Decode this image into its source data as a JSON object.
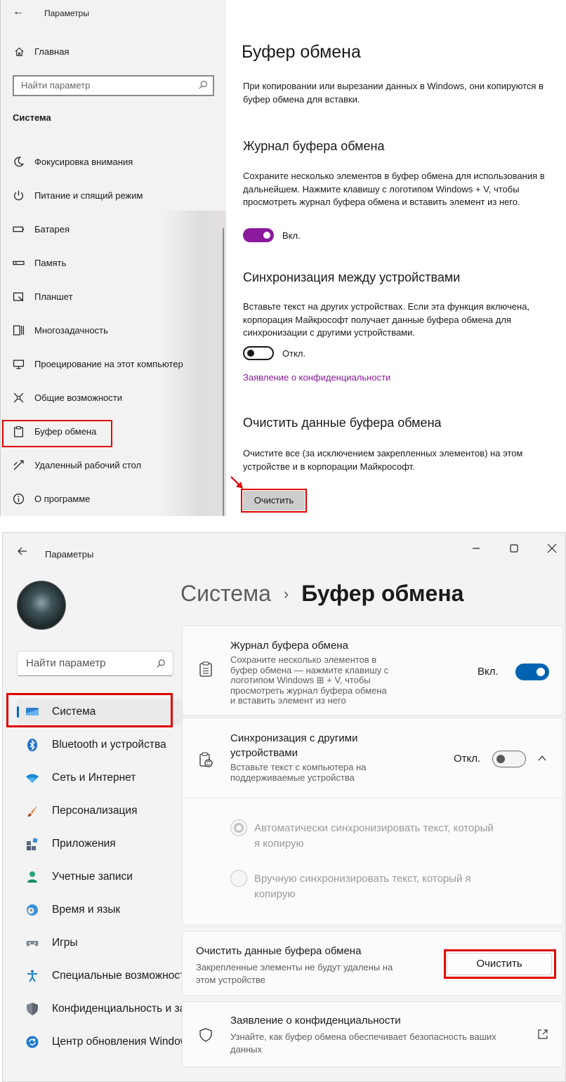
{
  "w10": {
    "app_title": "Параметры",
    "home_label": "Главная",
    "search_placeholder": "Найти параметр",
    "section_title": "Система",
    "nav": [
      {
        "label": "Фокусировка внимания",
        "icon": "moon-icon"
      },
      {
        "label": "Питание и спящий режим",
        "icon": "power-icon"
      },
      {
        "label": "Батарея",
        "icon": "battery-icon"
      },
      {
        "label": "Память",
        "icon": "storage-icon"
      },
      {
        "label": "Планшет",
        "icon": "tablet-icon"
      },
      {
        "label": "Многозадачность",
        "icon": "multitasking-icon"
      },
      {
        "label": "Проецирование на этот компьютер",
        "icon": "projecting-icon"
      },
      {
        "label": "Общие возможности",
        "icon": "shared-experiences-icon"
      },
      {
        "label": "Буфер обмена",
        "icon": "clipboard-icon",
        "selected": true
      },
      {
        "label": "Удаленный рабочий стол",
        "icon": "remote-desktop-icon"
      },
      {
        "label": "О программе",
        "icon": "info-icon"
      }
    ],
    "page_title": "Буфер обмена",
    "intro": "При копировании или вырезании данных в Windows, они копируются в буфер обмена для вставки.",
    "history": {
      "title": "Журнал буфера обмена",
      "desc": "Сохраните несколько элементов в буфер обмена для использования в дальнейшем. Нажмите клавишу с логотипом Windows + V, чтобы просмотреть журнал буфера обмена и вставить элемент из него.",
      "state": "Вкл."
    },
    "sync": {
      "title": "Синхронизация между устройствами",
      "desc": "Вставьте текст на других устройствах. Если эта функция включена, корпорация Майкрософт получает данные буфера обмена для синхронизации с другими устройствами.",
      "state": "Откл."
    },
    "privacy_link": "Заявление о конфиденциальности",
    "clear": {
      "title": "Очистить данные буфера обмена",
      "desc": "Очистите все (за исключением закрепленных элементов) на этом устройстве и в корпорации Майкрософт.",
      "button": "Очистить"
    },
    "colors": {
      "accent": "#8a1a9b",
      "highlight": "#e00000"
    }
  },
  "w11": {
    "app_title": "Параметры",
    "search_placeholder": "Найти параметр",
    "nav": [
      {
        "label": "Система",
        "icon": "display-icon",
        "selected": true
      },
      {
        "label": "Bluetooth и устройства",
        "icon": "bluetooth-icon"
      },
      {
        "label": "Сеть и Интернет",
        "icon": "wifi-icon"
      },
      {
        "label": "Персонализация",
        "icon": "brush-icon"
      },
      {
        "label": "Приложения",
        "icon": "apps-icon"
      },
      {
        "label": "Учетные записи",
        "icon": "person-icon"
      },
      {
        "label": "Время и язык",
        "icon": "globe-clock-icon"
      },
      {
        "label": "Игры",
        "icon": "gamepad-icon"
      },
      {
        "label": "Специальные возможности",
        "icon": "accessibility-icon"
      },
      {
        "label": "Конфиденциальность и защита",
        "icon": "shield-icon"
      },
      {
        "label": "Центр обновления Windows",
        "icon": "update-icon"
      }
    ],
    "breadcrumb": {
      "parent": "Система",
      "separator": "›",
      "current": "Буфер обмена"
    },
    "history": {
      "title": "Журнал буфера обмена",
      "desc_lines": [
        "Сохраните несколько элементов в",
        "буфер обмена — нажмите клавишу с",
        "логотипом Windows ⊞ + V, чтобы",
        "просмотреть журнал буфера обмена",
        "и вставить элемент из него"
      ],
      "state": "Вкл."
    },
    "sync": {
      "title_lines": [
        "Синхронизация с другими",
        "устройствами"
      ],
      "desc_lines": [
        "Вставьте текст с компьютера на",
        "поддерживаемые устройства"
      ],
      "state": "Откл.",
      "options": [
        {
          "lines": [
            "Автоматически синхронизировать текст, который",
            "я копирую"
          ]
        },
        {
          "lines": [
            "Вручную синхронизировать текст, который я",
            "копирую"
          ]
        }
      ]
    },
    "clear": {
      "title": "Очистить данные буфера обмена",
      "desc_lines": [
        "Закрепленные элементы не будут удалены на",
        "этом устройстве"
      ],
      "button": "Очистить"
    },
    "privacy": {
      "title": "Заявление о конфиденциальности",
      "desc_lines": [
        "Узнайте, как буфер обмена обеспечивает безопасность ваших",
        "данных"
      ]
    },
    "colors": {
      "accent": "#0063b1",
      "highlight": "#e00000"
    }
  }
}
